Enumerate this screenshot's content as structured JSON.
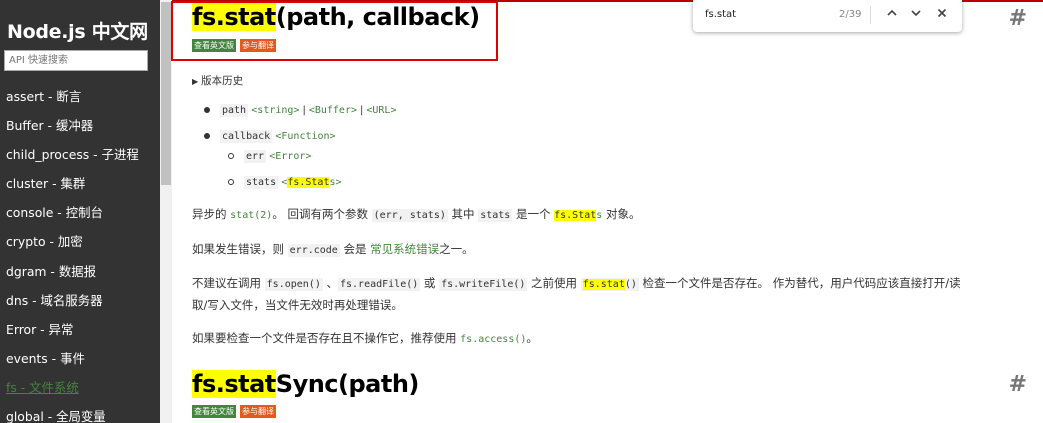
{
  "sidebar": {
    "brand": "Node.js 中文网",
    "search_placeholder": "API 快速搜索",
    "items": [
      {
        "label": "assert - 断言"
      },
      {
        "label": "Buffer - 缓冲器"
      },
      {
        "label": "child_process - 子进程"
      },
      {
        "label": "cluster - 集群"
      },
      {
        "label": "console - 控制台"
      },
      {
        "label": "crypto - 加密"
      },
      {
        "label": "dgram - 数据报"
      },
      {
        "label": "dns - 域名服务器"
      },
      {
        "label": "Error - 异常"
      },
      {
        "label": "events - 事件"
      },
      {
        "label": "fs - 文件系统"
      },
      {
        "label": "global - 全局变量"
      }
    ],
    "active_index": 10
  },
  "find_bar": {
    "query": "fs.stat",
    "count": "2/39",
    "prev_icon": "chevron-up-icon",
    "next_icon": "chevron-down-icon",
    "close_icon": "close-icon"
  },
  "section1": {
    "title_highlight": "fs.stat",
    "title_rest": "(path, callback)",
    "badge_en": "查看英文版",
    "badge_tr": "参与翻译",
    "anchor": "#",
    "history": "版本历史",
    "params": {
      "path": {
        "name": "path",
        "types": [
          "<string>",
          "<Buffer>",
          "<URL>"
        ]
      },
      "callback": {
        "name": "callback",
        "type": "<Function>"
      },
      "err": {
        "name": "err",
        "type": "<Error>"
      },
      "stats": {
        "name": "stats",
        "type_pre": "<",
        "type_hl": "fs.Stat",
        "type_post": "s>"
      }
    },
    "p1": {
      "t1": "异步的 ",
      "c1": "stat(2)",
      "t2": "。 回调有两个参数 ",
      "c2": "(err, stats)",
      "t3": " 其中 ",
      "c3": "stats",
      "t4": " 是一个 ",
      "c4_hl": "fs.Stat",
      "c4_post": "s",
      "t5": " 对象。"
    },
    "p2": {
      "t1": "如果发生错误，则 ",
      "c1": "err.code",
      "t2": " 会是 ",
      "link": "常见系统错误",
      "t3": "之一。"
    },
    "p3": {
      "t1": "不建议在调用 ",
      "c1": "fs.open()",
      "t2": " 、",
      "c2": "fs.readFile()",
      "t3": " 或 ",
      "c3": "fs.writeFile()",
      "t4": " 之前使用 ",
      "c4_hl": "fs.stat",
      "c4_post": "()",
      "t5": " 检查一个文件是否存在。 作为替代，用户代码应该直接打开/读",
      "line2": "取/写入文件，当文件无效时再处理错误。"
    },
    "p4": {
      "t1": "如果要检查一个文件是否存在且不操作它，推荐使用 ",
      "c1": "fs.access()",
      "t2": "。"
    }
  },
  "section2": {
    "title_highlight": "fs.stat",
    "title_rest": "Sync(path)",
    "badge_en": "查看英文版",
    "badge_tr": "参与翻译",
    "anchor": "#"
  },
  "colors": {
    "sidebar_bg": "#333333",
    "accent_green": "#43853d",
    "badge_orange": "#e25a1c",
    "highlight": "#ffff00",
    "annotation_box": "#e00000"
  }
}
